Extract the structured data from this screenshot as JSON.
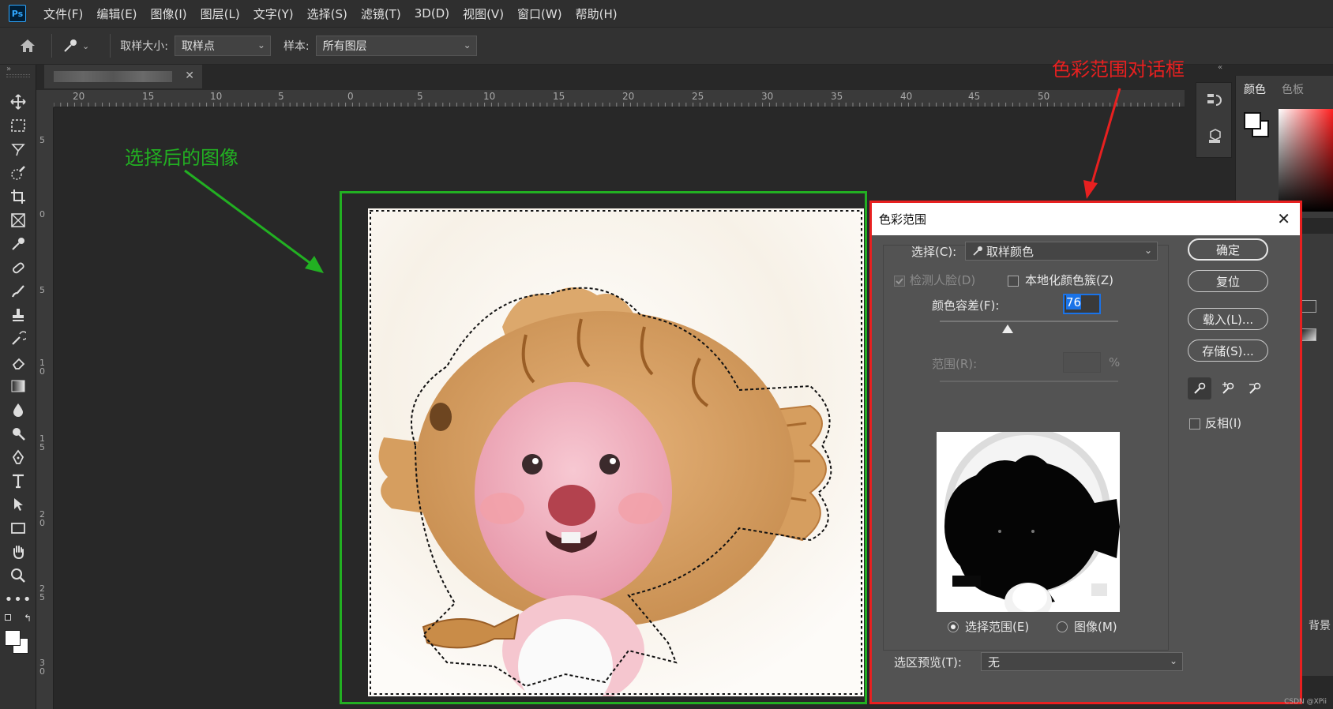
{
  "menu": [
    "文件(F)",
    "编辑(E)",
    "图像(I)",
    "图层(L)",
    "文字(Y)",
    "选择(S)",
    "滤镜(T)",
    "3D(D)",
    "视图(V)",
    "窗口(W)",
    "帮助(H)"
  ],
  "options": {
    "sample_size_label": "取样大小:",
    "sample_size_value": "取样点",
    "sample_label": "样本:",
    "sample_value": "所有图层"
  },
  "rulers": {
    "h_ticks": [
      "20",
      "15",
      "10",
      "5",
      "0",
      "5",
      "10",
      "15",
      "20",
      "25",
      "30",
      "35",
      "40",
      "45",
      "50"
    ],
    "v_ticks": [
      "5",
      "0",
      "5",
      "1 0",
      "1 5",
      "2 0",
      "2 5",
      "3 0"
    ]
  },
  "annotations": {
    "green": "选择后的图像",
    "red": "色彩范围对话框"
  },
  "color_panel": {
    "tab_color": "颜色",
    "tab_swatches": "色板"
  },
  "right_partial": {
    "item_bg": "背景"
  },
  "dialog": {
    "title": "色彩范围",
    "select_label": "选择(C):",
    "select_value": "取样颜色",
    "detect_faces": "检测人脸(D)",
    "localized_clusters": "本地化颜色簇(Z)",
    "fuzziness_label": "颜色容差(F):",
    "fuzziness_value": "76",
    "fuzziness_level": 0.38,
    "range_label": "范围(R):",
    "range_unit": "%",
    "radio_selection": "选择范围(E)",
    "radio_image": "图像(M)",
    "preview_label": "选区预览(T):",
    "preview_value": "无",
    "btn_ok": "确定",
    "btn_reset": "复位",
    "btn_load": "载入(L)...",
    "btn_save": "存储(S)...",
    "invert": "反相(I)"
  },
  "watermark": "CSDN @XPii"
}
